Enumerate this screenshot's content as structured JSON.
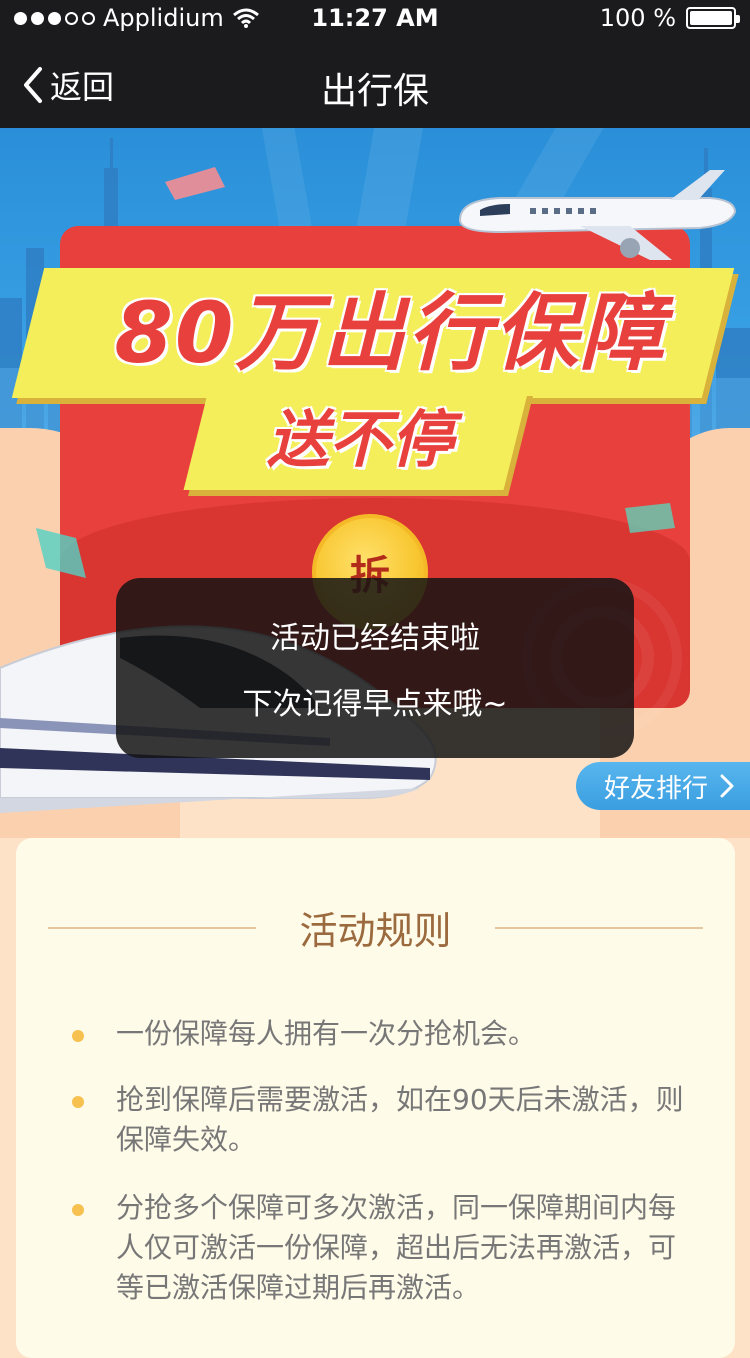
{
  "status_bar": {
    "carrier": "Applidium",
    "time": "11:27 AM",
    "battery": "100 %"
  },
  "nav": {
    "back_label": "返回",
    "title": "出行保"
  },
  "banner": {
    "headline_line1": "80万出行保障",
    "headline_line2": "送不停",
    "open_button_label": "拆"
  },
  "toast": {
    "line1": "活动已经结束啦",
    "line2": "下次记得早点来哦~"
  },
  "ranking_button": {
    "label": "好友排行"
  },
  "rules": {
    "title": "活动规则",
    "items": [
      {
        "text": "一份保障每人拥有一次分抢机会。"
      },
      {
        "text": "抢到保障后需要激活，如在90天后未激活，则保障失效。"
      },
      {
        "text": "分抢多个保障可多次激活，同一保障期间内每人仅可激活一份保障，超出后无法再激活，可等已激活保障过期后再激活。"
      }
    ]
  },
  "colors": {
    "nav_bg": "#1b1b1d",
    "envelope_red": "#e8403d",
    "headline_yellow": "#f4ee5a",
    "rules_title": "#9b6b3f",
    "bullet": "#f7c14f",
    "rank_blue": "#3a9ee0"
  }
}
